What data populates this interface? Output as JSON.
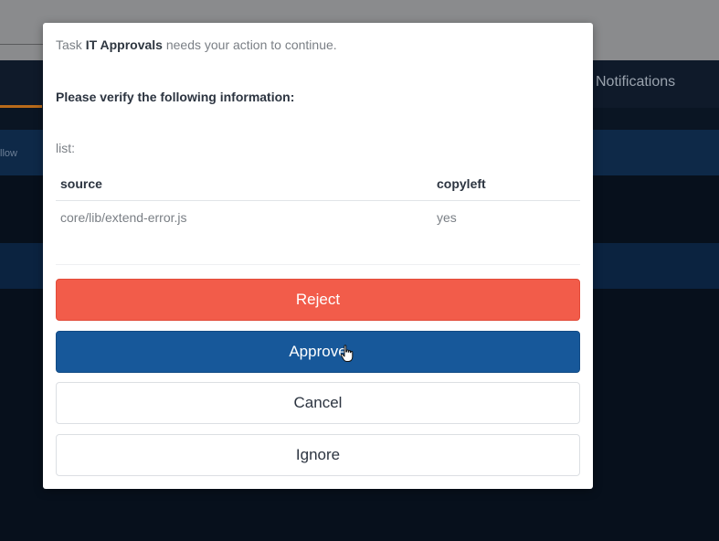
{
  "background": {
    "nav_item": "Notifications",
    "row_label": "llow"
  },
  "modal": {
    "message": {
      "prefix": "Task ",
      "task_name": "IT Approvals",
      "suffix": " needs your action to continue."
    },
    "verify_heading": "Please verify the following information:",
    "list_label": "list:",
    "table": {
      "headers": [
        "source",
        "copyleft"
      ],
      "rows": [
        [
          "core/lib/extend-error.js",
          "yes"
        ]
      ]
    },
    "buttons": {
      "reject": "Reject",
      "approve": "Approve",
      "cancel": "Cancel",
      "ignore": "Ignore"
    }
  },
  "colors": {
    "reject": "#f25c4a",
    "approve": "#17589a",
    "overlay": "#07101c"
  },
  "icons": {
    "cursor": "hand-pointer-icon"
  }
}
